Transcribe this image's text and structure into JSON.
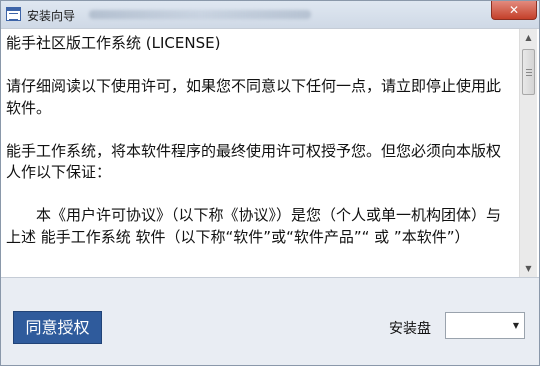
{
  "window": {
    "title": "安装向导",
    "close_label": "✕"
  },
  "license": {
    "heading": "能手社区版工作系统 (LICENSE)",
    "para1": "请仔细阅读以下使用许可，如果您不同意以下任何一点，请立即停止使用此软件。",
    "para2": "能手工作系统，将本软件程序的最终使用许可权授予您。但您必须向本版权人作以下保证：",
    "para3": "本《用户许可协议》（以下称《协议》）是您（个人或单一机构团体）与上述 能手工作系统 软件（以下称“软件”或“软件产品”“ 或 ”本软件”）"
  },
  "scrollbar": {
    "up_icon": "▲",
    "down_icon": "▼"
  },
  "footer": {
    "agree_label": "同意授权",
    "disk_label": "安装盘",
    "disk_value": "",
    "dropdown_icon": "▼"
  },
  "colors": {
    "accent": "#2f5b9c",
    "close": "#c4402a"
  }
}
